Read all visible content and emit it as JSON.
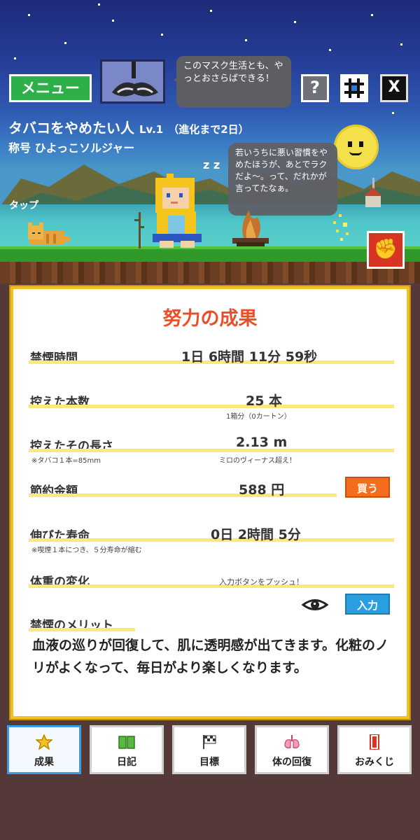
{
  "header": {
    "menu_label": "メニュー",
    "speech_text": "このマスク生活とも、やっとおさらばできる！",
    "help_label": "?",
    "x_label": "X"
  },
  "profile": {
    "name": "タバコをやめたい人",
    "level": "Lv.1",
    "evolution": "（進化まで2日）",
    "rank": "称号 ひよっこソルジャー"
  },
  "scene": {
    "thought_text": "若いうちに悪い習慣をやめたほうが、あとでラクだよ〜。って、だれかが言ってたなぁ。",
    "tap_label": "タップ",
    "sleep_label": "z z"
  },
  "results": {
    "title": "努力の成果",
    "abstinence_time": {
      "label": "禁煙時間",
      "value": "1日 6時間 11分 59秒"
    },
    "cigarettes": {
      "label": "控えた本数",
      "value": "25 本",
      "note": "1箱分（0カートン）"
    },
    "length": {
      "label": "控えたその長さ",
      "value": "2.13 m",
      "sub": "※タバコ１本=85mm",
      "note": "ミロのヴィーナス超え！"
    },
    "savings": {
      "label": "節約金額",
      "value": "588 円",
      "button": "買う"
    },
    "lifespan": {
      "label": "伸びた寿命",
      "value": "0日 2時間 5分",
      "sub": "※喫煙１本につき、５分寿命が縮む"
    },
    "weight": {
      "label": "体重の変化",
      "note": "入力ボタンをプッシュ！",
      "button": "入力"
    },
    "merit": {
      "label": "禁煙のメリット",
      "text": "血液の巡りが回復して、肌に透明感が出てきます。化粧のノリがよくなって、毎日がより楽しくなります。"
    }
  },
  "nav": [
    {
      "label": "成果",
      "icon": "star-icon"
    },
    {
      "label": "日記",
      "icon": "book-icon"
    },
    {
      "label": "目標",
      "icon": "flag-icon"
    },
    {
      "label": "体の回復",
      "icon": "lungs-icon"
    },
    {
      "label": "おみくじ",
      "icon": "fortune-icon"
    }
  ],
  "colors": {
    "accent": "#e8502a",
    "menu_green": "#2db049",
    "buy_orange": "#f36d1c",
    "input_blue": "#2b9ee0",
    "panel_border": "#f1c21f"
  }
}
